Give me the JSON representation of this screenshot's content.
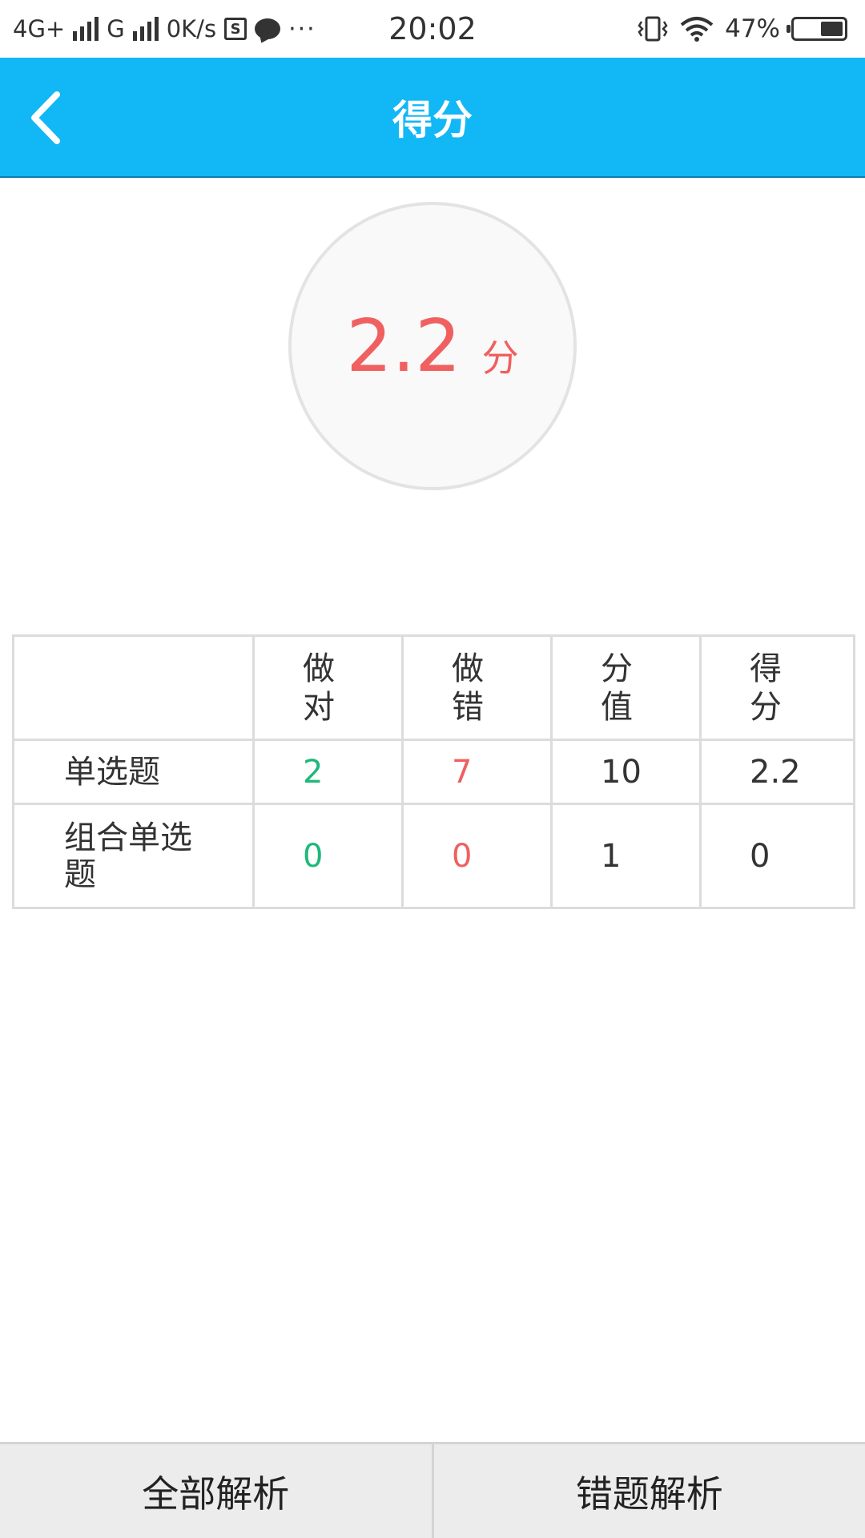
{
  "status_bar": {
    "network_1": "4G+",
    "network_2": "G",
    "speed": "0K/s",
    "dots": "···",
    "time": "20:02",
    "battery": "47%",
    "battery_level": 0.47
  },
  "header": {
    "title": "得分",
    "back_icon": "chevron-left-icon",
    "background": "#12b7f5"
  },
  "score": {
    "value": "2.2",
    "unit": "分",
    "color": "#f06060"
  },
  "table": {
    "headers": [
      "",
      "做对",
      "做错",
      "分值",
      "得分"
    ],
    "rows": [
      {
        "label": "单选题",
        "correct": "2",
        "wrong": "7",
        "points": "10",
        "score": "2.2"
      },
      {
        "label": "组合单选题",
        "correct": "0",
        "wrong": "0",
        "points": "1",
        "score": "0"
      }
    ],
    "correct_color": "#1fb87a",
    "wrong_color": "#f06060"
  },
  "bottom": {
    "all_analysis": "全部解析",
    "wrong_analysis": "错题解析"
  }
}
